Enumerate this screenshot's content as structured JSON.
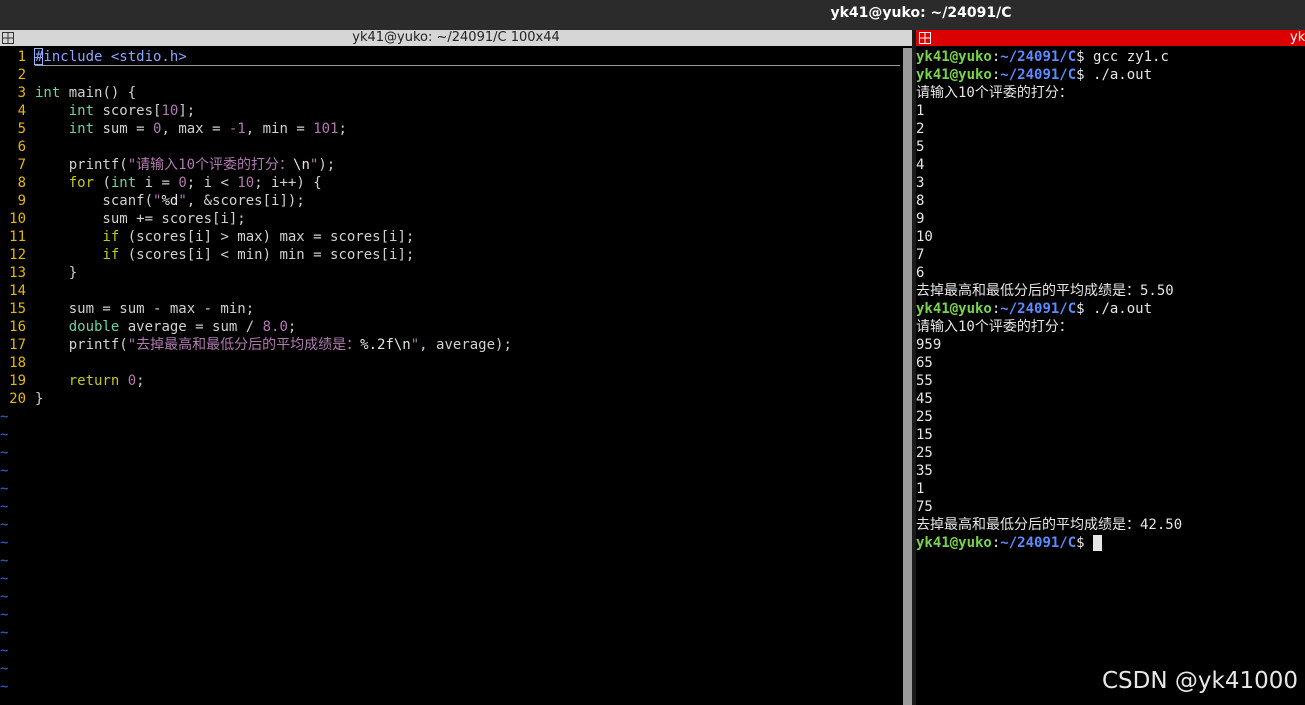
{
  "window": {
    "title": "yk41@yuko: ~/24091/C"
  },
  "left_pane": {
    "title": "yk41@yuko: ~/24091/C 100x44",
    "lines": [
      {
        "n": "1",
        "html": "<span class=\"pp\">#include &lt;stdio.h&gt;</span>"
      },
      {
        "n": "2",
        "html": ""
      },
      {
        "n": "3",
        "html": "<span class=\"ty\">int</span> main() {"
      },
      {
        "n": "4",
        "html": "    <span class=\"ty\">int</span> scores[<span class=\"num\">10</span>];"
      },
      {
        "n": "5",
        "html": "    <span class=\"ty\">int</span> sum = <span class=\"num\">0</span>, max = <span class=\"num\">-1</span>, min = <span class=\"num\">101</span>;"
      },
      {
        "n": "6",
        "html": ""
      },
      {
        "n": "7",
        "html": "    printf(<span class=\"str\">\"请输入10个评委的打分：</span><span class=\"esc\">\\n</span><span class=\"str\">\"</span>);"
      },
      {
        "n": "8",
        "html": "    <span class=\"kw\">for</span> (<span class=\"ty\">int</span> i = <span class=\"num\">0</span>; i &lt; <span class=\"num\">10</span>; i++) {"
      },
      {
        "n": "9",
        "html": "        scanf(<span class=\"str\">\"</span><span class=\"esc\">%d</span><span class=\"str\">\"</span>, &amp;scores[i]);"
      },
      {
        "n": "10",
        "html": "        sum += scores[i];"
      },
      {
        "n": "11",
        "html": "        <span class=\"kw\">if</span> (scores[i] &gt; max) max = scores[i];"
      },
      {
        "n": "12",
        "html": "        <span class=\"kw\">if</span> (scores[i] &lt; min) min = scores[i];"
      },
      {
        "n": "13",
        "html": "    }"
      },
      {
        "n": "14",
        "html": ""
      },
      {
        "n": "15",
        "html": "    sum = sum - max - min;"
      },
      {
        "n": "16",
        "html": "    <span class=\"ty\">double</span> average = sum / <span class=\"num\">8.0</span>;"
      },
      {
        "n": "17",
        "html": "    printf(<span class=\"str\">\"去掉最高和最低分后的平均成绩是：</span><span class=\"esc\">%.2f\\n</span><span class=\"str\">\"</span>, average);"
      },
      {
        "n": "18",
        "html": ""
      },
      {
        "n": "19",
        "html": "    <span class=\"kw\">return</span> <span class=\"num\">0</span>;"
      },
      {
        "n": "20",
        "html": "}"
      }
    ],
    "tilde_char": "~",
    "tilde_count": 16
  },
  "right_pane": {
    "title": "yk",
    "prompt_user": "yk41@yuko",
    "prompt_sep": ":",
    "prompt_path": "~/24091/C",
    "prompt_end": "$ ",
    "lines": [
      {
        "prompt": true,
        "text": "gcc zy1.c"
      },
      {
        "prompt": true,
        "text": "./a.out"
      },
      {
        "prompt": false,
        "text": "请输入10个评委的打分："
      },
      {
        "prompt": false,
        "text": "1"
      },
      {
        "prompt": false,
        "text": "2"
      },
      {
        "prompt": false,
        "text": "5"
      },
      {
        "prompt": false,
        "text": "4"
      },
      {
        "prompt": false,
        "text": "3"
      },
      {
        "prompt": false,
        "text": "8"
      },
      {
        "prompt": false,
        "text": "9"
      },
      {
        "prompt": false,
        "text": "10"
      },
      {
        "prompt": false,
        "text": "7"
      },
      {
        "prompt": false,
        "text": "6"
      },
      {
        "prompt": false,
        "text": "去掉最高和最低分后的平均成绩是：5.50"
      },
      {
        "prompt": true,
        "text": "./a.out"
      },
      {
        "prompt": false,
        "text": "请输入10个评委的打分："
      },
      {
        "prompt": false,
        "text": "959"
      },
      {
        "prompt": false,
        "text": "65"
      },
      {
        "prompt": false,
        "text": "55"
      },
      {
        "prompt": false,
        "text": "45"
      },
      {
        "prompt": false,
        "text": "25"
      },
      {
        "prompt": false,
        "text": "15"
      },
      {
        "prompt": false,
        "text": "25"
      },
      {
        "prompt": false,
        "text": "35"
      },
      {
        "prompt": false,
        "text": "1"
      },
      {
        "prompt": false,
        "text": "75"
      },
      {
        "prompt": false,
        "text": "去掉最高和最低分后的平均成绩是：42.50"
      },
      {
        "prompt": true,
        "text": "",
        "cursor": true
      }
    ]
  },
  "watermark": "CSDN @yk41000"
}
